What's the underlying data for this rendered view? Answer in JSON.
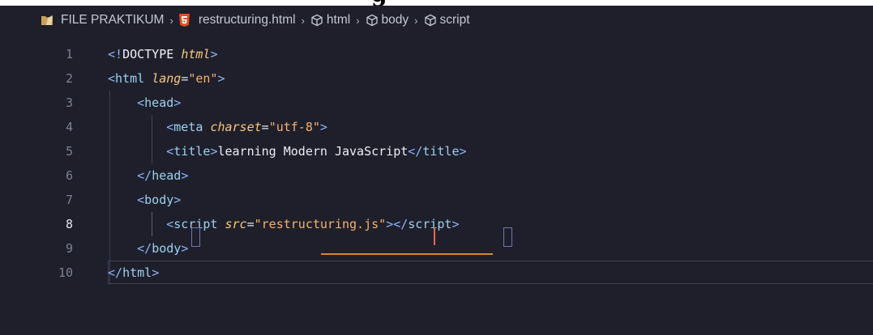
{
  "page": {
    "top_strip_text": "g"
  },
  "breadcrumb": {
    "items": [
      {
        "label": "FILE PRAKTIKUM",
        "icon": "folder-icon"
      },
      {
        "label": "restructuring.html",
        "icon": "html5-icon"
      },
      {
        "label": "html",
        "icon": "cube-icon"
      },
      {
        "label": "body",
        "icon": "cube-icon"
      },
      {
        "label": "script",
        "icon": "cube-icon"
      }
    ],
    "separator": "›"
  },
  "editor": {
    "active_line": 8,
    "lines": [
      {
        "number": "1",
        "tokens": [
          {
            "t": "<!",
            "c": "punct"
          },
          {
            "t": "DOCTYPE ",
            "c": "keyword"
          },
          {
            "t": "html",
            "c": "attr"
          },
          {
            "t": ">",
            "c": "punct"
          }
        ]
      },
      {
        "number": "2",
        "tokens": [
          {
            "t": "<",
            "c": "punct"
          },
          {
            "t": "html",
            "c": "tag"
          },
          {
            "t": " ",
            "c": "text"
          },
          {
            "t": "lang",
            "c": "attr"
          },
          {
            "t": "=",
            "c": "eq"
          },
          {
            "t": "\"en\"",
            "c": "str"
          },
          {
            "t": ">",
            "c": "punct"
          }
        ]
      },
      {
        "number": "3",
        "tokens": [
          {
            "t": "    ",
            "c": "text"
          },
          {
            "t": "<",
            "c": "punct"
          },
          {
            "t": "head",
            "c": "tag"
          },
          {
            "t": ">",
            "c": "punct"
          }
        ]
      },
      {
        "number": "4",
        "tokens": [
          {
            "t": "        ",
            "c": "text"
          },
          {
            "t": "<",
            "c": "punct"
          },
          {
            "t": "meta",
            "c": "tag"
          },
          {
            "t": " ",
            "c": "text"
          },
          {
            "t": "charset",
            "c": "attr"
          },
          {
            "t": "=",
            "c": "eq"
          },
          {
            "t": "\"utf-8\"",
            "c": "str"
          },
          {
            "t": ">",
            "c": "punct"
          }
        ]
      },
      {
        "number": "5",
        "tokens": [
          {
            "t": "        ",
            "c": "text"
          },
          {
            "t": "<",
            "c": "punct"
          },
          {
            "t": "title",
            "c": "tag"
          },
          {
            "t": ">",
            "c": "punct"
          },
          {
            "t": "learning Modern JavaScript",
            "c": "text"
          },
          {
            "t": "</",
            "c": "punct"
          },
          {
            "t": "title",
            "c": "tag"
          },
          {
            "t": ">",
            "c": "punct"
          }
        ]
      },
      {
        "number": "6",
        "tokens": [
          {
            "t": "    ",
            "c": "text"
          },
          {
            "t": "</",
            "c": "punct"
          },
          {
            "t": "head",
            "c": "tag"
          },
          {
            "t": ">",
            "c": "punct"
          }
        ]
      },
      {
        "number": "7",
        "tokens": [
          {
            "t": "    ",
            "c": "text"
          },
          {
            "t": "<",
            "c": "punct"
          },
          {
            "t": "body",
            "c": "tag"
          },
          {
            "t": ">",
            "c": "punct"
          }
        ]
      },
      {
        "number": "8",
        "tokens": [
          {
            "t": "        ",
            "c": "text"
          },
          {
            "t": "<",
            "c": "punct"
          },
          {
            "t": "script",
            "c": "tag"
          },
          {
            "t": " ",
            "c": "text"
          },
          {
            "t": "src",
            "c": "attr"
          },
          {
            "t": "=",
            "c": "eq"
          },
          {
            "t": "\"restructuring.js\"",
            "c": "str"
          },
          {
            "t": ">",
            "c": "punct"
          },
          {
            "t": "</",
            "c": "punct"
          },
          {
            "t": "script",
            "c": "tag"
          },
          {
            "t": ">",
            "c": "punct"
          }
        ]
      },
      {
        "number": "9",
        "tokens": [
          {
            "t": "    ",
            "c": "text"
          },
          {
            "t": "</",
            "c": "punct"
          },
          {
            "t": "body",
            "c": "tag"
          },
          {
            "t": ">",
            "c": "punct"
          }
        ]
      },
      {
        "number": "10",
        "tokens": [
          {
            "t": "</",
            "c": "punct"
          },
          {
            "t": "html",
            "c": "tag"
          },
          {
            "t": ">",
            "c": "punct"
          }
        ]
      }
    ]
  },
  "colors": {
    "editor_bg": "#1f1f2b",
    "line_number": "#7e8094",
    "active_line_number": "#e3e5ee",
    "tag": "#9bd2f0",
    "punctuation": "#89b4fa",
    "attribute": "#f8c97c",
    "string": "#f6b26b",
    "text": "#eceef4",
    "squiggle": "#d6882f",
    "cursor": "#e8684a",
    "html5_badge": "#e44d26"
  }
}
